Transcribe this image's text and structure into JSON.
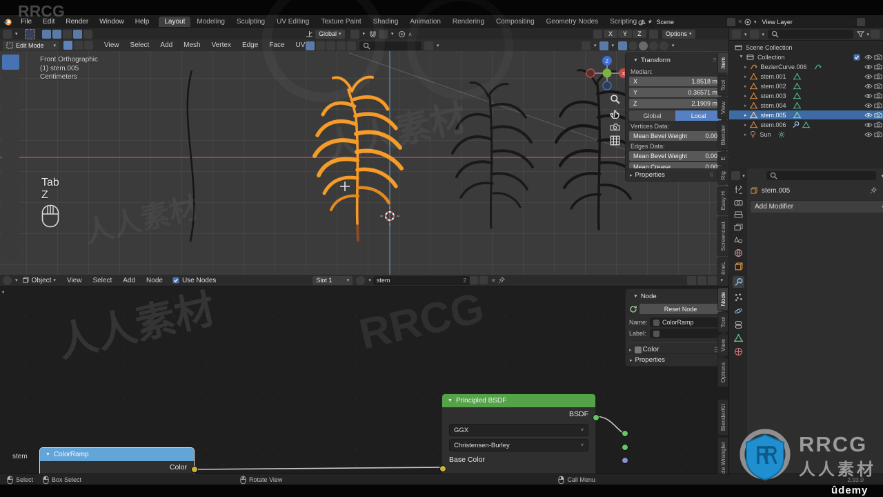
{
  "topbar": {
    "menus": [
      "File",
      "Edit",
      "Render",
      "Window",
      "Help"
    ],
    "workspaces": [
      "Layout",
      "Modeling",
      "Sculpting",
      "UV Editing",
      "Texture Paint",
      "Shading",
      "Animation",
      "Rendering",
      "Compositing",
      "Geometry Nodes",
      "Scripting"
    ],
    "add_workspace": "+",
    "scene": "Scene",
    "view_layer": "View Layer"
  },
  "tool_settings": {
    "orientation": "Global",
    "mirror_x": "X",
    "mirror_y": "Y",
    "mirror_z": "Z",
    "options": "Options"
  },
  "view3d": {
    "mode": "Edit Mode",
    "menus": [
      "View",
      "Select",
      "Add",
      "Mesh",
      "Vertex",
      "Edge",
      "Face",
      "UV"
    ],
    "overlay": {
      "l1": "Front Orthographic",
      "l2": "(1) stem.005",
      "l3": "Centimeters"
    },
    "screencast": {
      "k1": "Tab",
      "k2": "Z"
    },
    "gizmo": {
      "x": "X",
      "z": "Z"
    },
    "sidebar_tabs": [
      "Item",
      "Tool",
      "View",
      "Blender",
      "E",
      "Rig",
      "Easy H",
      "Screencast",
      "LuxCoreOnlineL"
    ],
    "transform": {
      "title": "Transform",
      "median": "Median:",
      "x_label": "X",
      "x_value": "1.8518 m",
      "y_label": "Y",
      "y_value": "0.36571 m",
      "z_label": "Z",
      "z_value": "2.1909 m",
      "global": "Global",
      "local": "Local",
      "vertices_data": "Vertices Data:",
      "mean_bevel_v_label": "Mean Bevel Weight",
      "mean_bevel_v_value": "0.00",
      "edges_data": "Edges Data:",
      "mean_bevel_e_label": "Mean Bevel Weight",
      "mean_bevel_e_value": "0.00",
      "mean_crease_label": "Mean Crease",
      "mean_crease_value": "0.00",
      "properties": "Properties"
    }
  },
  "outliner": {
    "scene_collection": "Scene Collection",
    "collection": "Collection",
    "items": [
      {
        "name": "BezierCurve.006"
      },
      {
        "name": "stem.001"
      },
      {
        "name": "stem.002"
      },
      {
        "name": "stem.003"
      },
      {
        "name": "stem.004"
      },
      {
        "name": "stem.005"
      },
      {
        "name": "stem.006"
      },
      {
        "name": "Sun"
      }
    ]
  },
  "properties": {
    "breadcrumb": "stem.005",
    "add_modifier": "Add Modifier"
  },
  "node_editor": {
    "shader_type": "Object",
    "menus": [
      "View",
      "Select",
      "Add",
      "Node"
    ],
    "use_nodes": "Use Nodes",
    "slot": "Slot 1",
    "material": "stem",
    "users": "2",
    "material_tag": "stem",
    "sidebar": {
      "tabs": [
        "Node",
        "Tool",
        "View",
        "Options",
        "BlenderKit",
        "Node Wrangler"
      ],
      "panel": "Node",
      "reset": "Reset Node",
      "name_label": "Name:",
      "name_value": "ColorRamp",
      "label_label": "Label:",
      "color": "Color",
      "properties": "Properties"
    },
    "principled": {
      "title": "Principled BSDF",
      "out": "BSDF",
      "distribution": "GGX",
      "subsurface_method": "Christensen-Burley",
      "base_color": "Base Color"
    },
    "colorramp": {
      "title": "ColorRamp",
      "out": "Color"
    }
  },
  "status": {
    "select": "Select",
    "box_select": "Box Select",
    "rotate_view": "Rotate View",
    "call_menu": "Call Menu",
    "version": "2.93.0"
  },
  "branding": {
    "rrcg": "RRCG",
    "rrcg_cn": "人人素材",
    "udemy": "ûdemy",
    "wm_rrcg": "RRCG",
    "wm_cn": "人人素材"
  },
  "colors": {
    "accent": "#4772b3",
    "selection_orange": "#f59b28",
    "bsdf_green": "#55a349",
    "ramp_blue": "#64a5d8"
  }
}
